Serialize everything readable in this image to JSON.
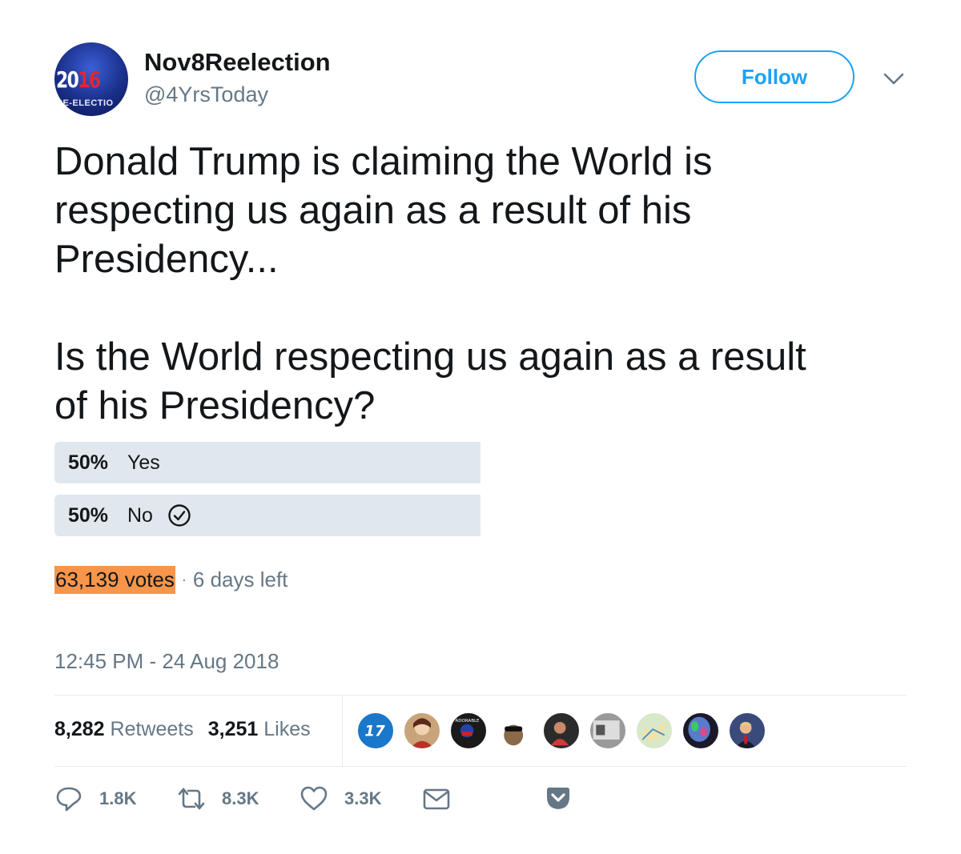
{
  "author": {
    "avatar_text_year_a": "20",
    "avatar_text_year_b": "16",
    "avatar_text_caption": "RE-ELECTIO",
    "display_name": "Nov8Reelection",
    "handle": "@4YrsToday"
  },
  "follow_label": "Follow",
  "tweet": {
    "text": "Donald Trump is claiming the World is\nrespecting us again as a result of his\nPresidency...\n\nIs the World respecting us again as a result\nof his Presidency?"
  },
  "poll": {
    "options": [
      {
        "percent": "50%",
        "label": "Yes",
        "fraction": 0.5,
        "selected": false
      },
      {
        "percent": "50%",
        "label": "No",
        "fraction": 0.5,
        "selected": true
      }
    ],
    "votes": "63,139 votes",
    "time_left": "6 days left",
    "separator": "·"
  },
  "timestamp": "12:45 PM - 24 Aug 2018",
  "stats": {
    "retweets_count": "8,282",
    "retweets_label": "Retweets",
    "likes_count": "3,251",
    "likes_label": "Likes"
  },
  "likers": [
    {
      "name": "liker-avatar-1",
      "color": "#1b77c9",
      "text": "17"
    },
    {
      "name": "liker-avatar-2",
      "color": "#c9a47a"
    },
    {
      "name": "liker-avatar-3",
      "color": "#1a1a1a",
      "text": "ADORABLE"
    },
    {
      "name": "liker-avatar-4",
      "color": "#8a6a48"
    },
    {
      "name": "liker-avatar-5",
      "color": "#2b2b2b"
    },
    {
      "name": "liker-avatar-6",
      "color": "#9a9a9a"
    },
    {
      "name": "liker-avatar-7",
      "color": "#d8e8c8"
    },
    {
      "name": "liker-avatar-8",
      "color": "#2a2f6b"
    },
    {
      "name": "liker-avatar-9",
      "color": "#3a4a7a"
    }
  ],
  "actions": {
    "reply_count": "1.8K",
    "retweet_count": "8.3K",
    "like_count": "3.3K"
  },
  "colors": {
    "accent": "#1da1f2",
    "muted": "#657786",
    "poll_bar": "#e1e8ed",
    "highlight": "#f7954a"
  }
}
